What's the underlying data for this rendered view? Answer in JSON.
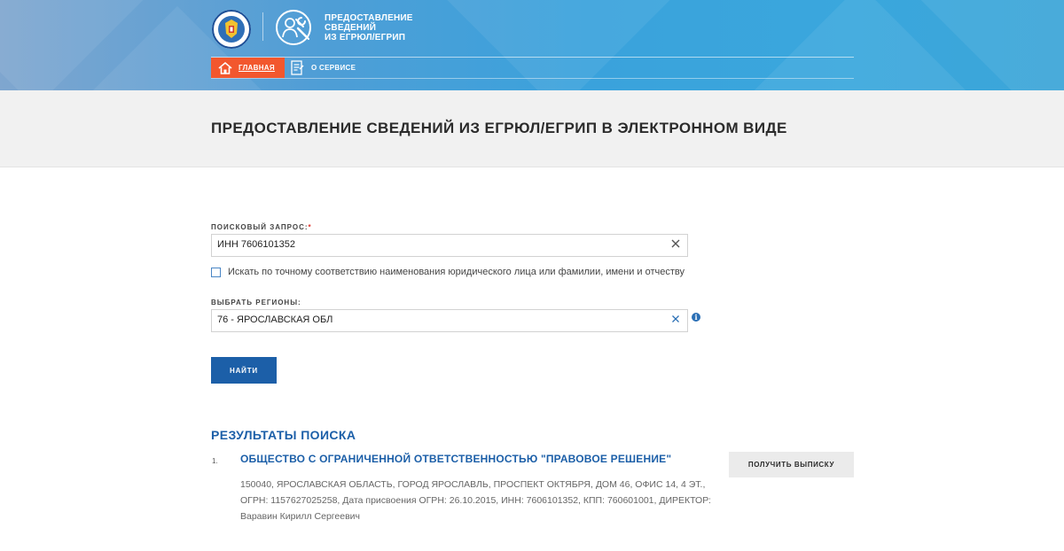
{
  "header": {
    "service_title_lines": [
      "ПРЕДОСТАВЛЕНИЕ",
      "СВЕДЕНИЙ",
      "ИЗ ЕГРЮЛ/ЕГРИП"
    ],
    "emblem_icon": "fns-emblem-icon",
    "service_icon": "worker-wrench-icon",
    "nav": {
      "home_label": "ГЛАВНАЯ",
      "about_label": "О СЕРВИСЕ"
    },
    "accent_color": "#f2572e"
  },
  "page": {
    "title": "ПРЕДОСТАВЛЕНИЕ СВЕДЕНИЙ ИЗ ЕГРЮЛ/ЕГРИП В ЭЛЕКТРОННОМ ВИДЕ"
  },
  "form": {
    "query_label": "ПОИСКОВЫЙ ЗАПРОС:",
    "query_required_mark": "*",
    "query_value": "ИНН 7606101352",
    "exact_match_label": "Искать по точному соответствию наименования юридического лица или фамилии, имени и отчеству",
    "exact_match_checked": false,
    "regions_label": "ВЫБРАТЬ РЕГИОНЫ:",
    "regions_value": "76 - ЯРОСЛАВСКАЯ ОБЛ",
    "info_glyph": "i",
    "submit_label": "НАЙТИ",
    "primary_color": "#1c5fa8"
  },
  "results": {
    "title": "РЕЗУЛЬТАТЫ ПОИСКА",
    "items": [
      {
        "number": "1.",
        "name": "ОБЩЕСТВО С ОГРАНИЧЕННОЙ ОТВЕТСТВЕННОСТЬЮ \"ПРАВОВОЕ РЕШЕНИЕ\"",
        "action_label": "ПОЛУЧИТЬ ВЫПИСКУ",
        "details": [
          "150040, ЯРОСЛАВСКАЯ ОБЛАСТЬ, ГОРОД ЯРОСЛАВЛЬ, ПРОСПЕКТ ОКТЯБРЯ, ДОМ 46, ОФИС 14, 4 ЭТ.,",
          "ОГРН: 1157627025258, Дата присвоения ОГРН: 26.10.2015, ИНН: 7606101352, КПП: 760601001, ДИРЕКТОР:",
          "Варавин Кирилл Сергеевич"
        ]
      }
    ]
  }
}
